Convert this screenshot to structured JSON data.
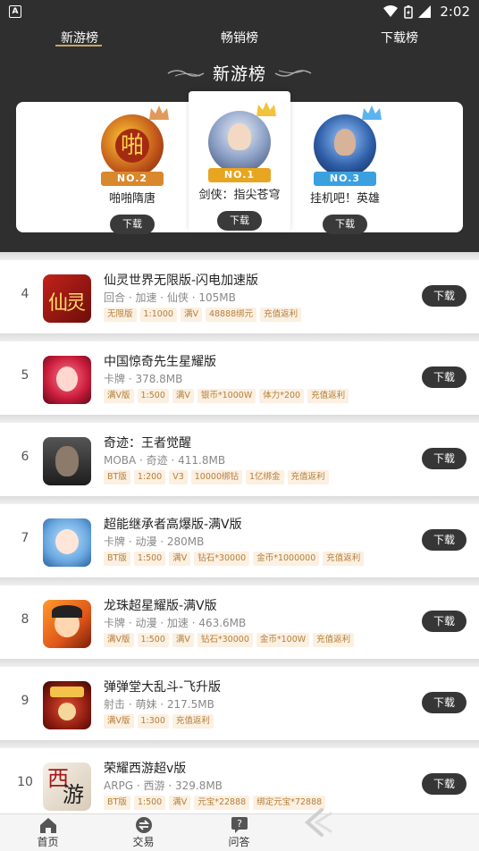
{
  "status_bar": {
    "time": "2:02",
    "notification_icon": "A"
  },
  "tabs": [
    {
      "label": "新游榜",
      "active": true
    },
    {
      "label": "畅销榜",
      "active": false
    },
    {
      "label": "下载榜",
      "active": false
    }
  ],
  "banner": {
    "title": "新游榜"
  },
  "podium": [
    {
      "rank_label": "NO.2",
      "name": "啪啪隋唐",
      "button": "下载",
      "ribbon_color": "#d9882c"
    },
    {
      "rank_label": "NO.1",
      "name": "剑侠：指尖苍穹",
      "button": "下载",
      "ribbon_color": "#e8a520"
    },
    {
      "rank_label": "NO.3",
      "name": "挂机吧！英雄",
      "button": "下载",
      "ribbon_color": "#3aa0e0"
    }
  ],
  "list": [
    {
      "rank": "4",
      "name": "仙灵世界无限版-闪电加速版",
      "meta": "回合 · 加速 · 仙侠 · 105MB",
      "tags": [
        "无限版",
        "1:1000",
        "满V",
        "48888绑元",
        "充值返利"
      ],
      "button": "下载"
    },
    {
      "rank": "5",
      "name": "中国惊奇先生星耀版",
      "meta": "卡牌 · 378.8MB",
      "tags": [
        "满V版",
        "1:500",
        "满V",
        "银币*1000W",
        "体力*200",
        "充值返利"
      ],
      "button": "下载"
    },
    {
      "rank": "6",
      "name": "奇迹：王者觉醒",
      "meta": "MOBA · 奇迹 · 411.8MB",
      "tags": [
        "BT版",
        "1:200",
        "V3",
        "10000绑钻",
        "1亿绑金",
        "充值返利"
      ],
      "button": "下载"
    },
    {
      "rank": "7",
      "name": "超能继承者高爆版-满V版",
      "meta": "卡牌 · 动漫 · 280MB",
      "tags": [
        "BT版",
        "1:500",
        "满V",
        "钻石*30000",
        "金币*1000000",
        "充值返利"
      ],
      "button": "下载"
    },
    {
      "rank": "8",
      "name": "龙珠超星耀版-满V版",
      "meta": "卡牌 · 动漫 · 加速 · 463.6MB",
      "tags": [
        "满V版",
        "1:500",
        "满V",
        "钻石*30000",
        "金币*100W",
        "充值返利"
      ],
      "button": "下载"
    },
    {
      "rank": "9",
      "name": "弹弹堂大乱斗-飞升版",
      "meta": "射击 · 萌妹 · 217.5MB",
      "tags": [
        "满V版",
        "1:300",
        "充值返利"
      ],
      "button": "下载"
    },
    {
      "rank": "10",
      "name": "荣耀西游超v版",
      "meta": "ARPG · 西游 · 329.8MB",
      "tags": [
        "BT版",
        "1:500",
        "满V",
        "元宝*22888",
        "绑定元宝*72888"
      ],
      "button": "下载"
    }
  ],
  "bottom_nav": [
    {
      "label": "首页",
      "icon": "home-icon"
    },
    {
      "label": "交易",
      "icon": "exchange-icon"
    },
    {
      "label": "问答",
      "icon": "qa-icon"
    }
  ],
  "colors": {
    "dark": "#2f2f2f",
    "accent": "#c8a46a",
    "tag_text": "#b57f3a",
    "tag_bg": "#fbf0e2"
  }
}
